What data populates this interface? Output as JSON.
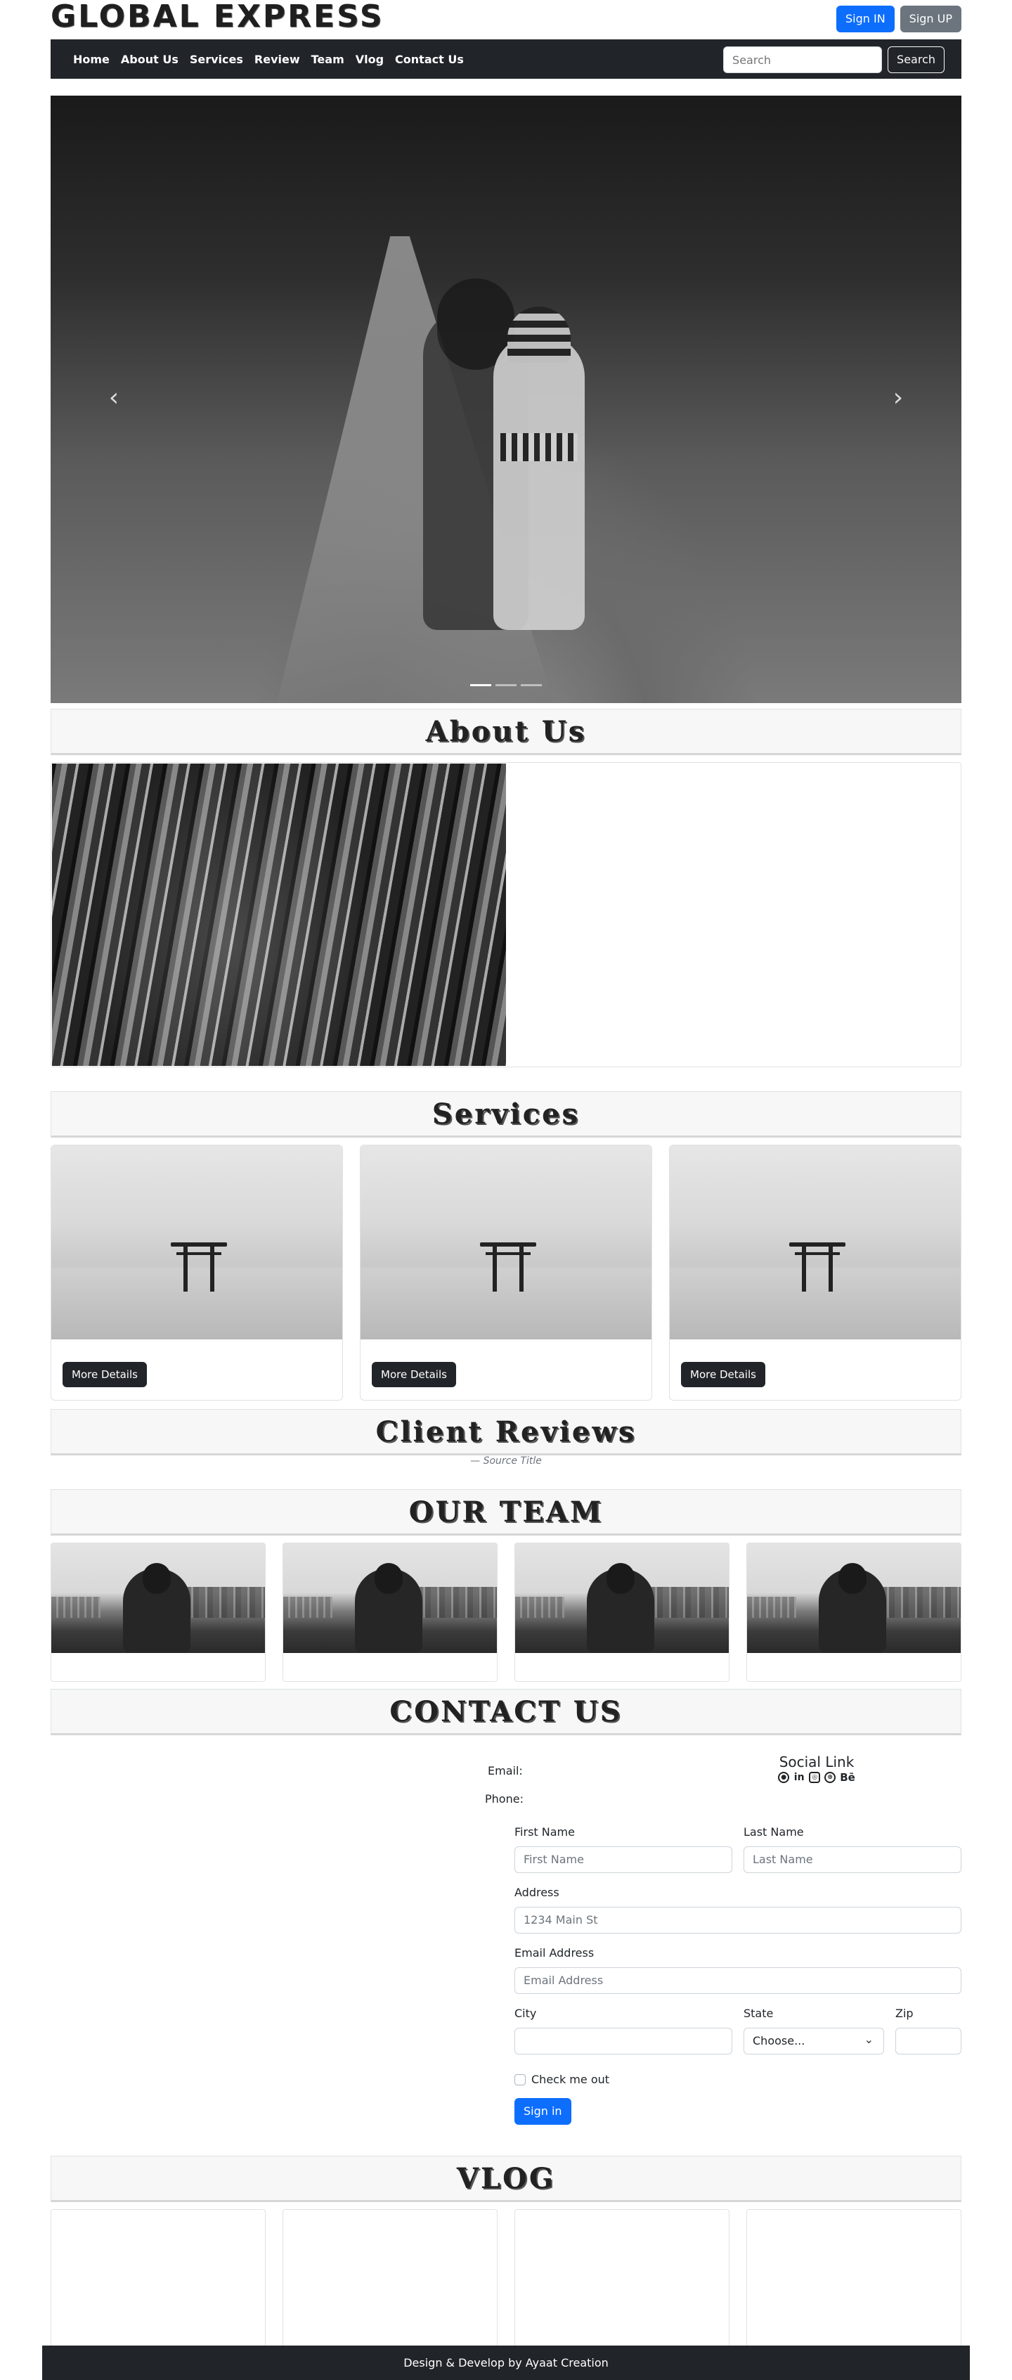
{
  "brand": "GLOBAL EXPRESS",
  "auth": {
    "sign_in": "Sign IN",
    "sign_up": "Sign UP"
  },
  "nav": {
    "items": [
      "Home",
      "About Us",
      "Services",
      "Review",
      "Team",
      "Vlog",
      "Contact Us"
    ],
    "search_placeholder": "Search",
    "search_button": "Search"
  },
  "carousel": {
    "prev_icon": "chevron-left-icon",
    "next_icon": "chevron-right-icon",
    "slide_count": 3,
    "active_slide": 1
  },
  "sections": {
    "about": "About Us",
    "services": "Services",
    "reviews": "Client Reviews",
    "team": "OUR TEAM",
    "contact": "CONTACT US",
    "vlog": "VLOG"
  },
  "services": {
    "cards": [
      {
        "button": "More Details"
      },
      {
        "button": "More Details"
      },
      {
        "button": "More Details"
      }
    ]
  },
  "reviews": {
    "source": "— Source Title"
  },
  "contact": {
    "email_label": "Email:",
    "phone_label": "Phone:",
    "social_title": "Social Link",
    "social_icons": [
      "github-icon",
      "linkedin-icon",
      "instagram-icon",
      "dribbble-icon",
      "behance-icon"
    ],
    "behance_text": "Bē"
  },
  "form": {
    "first_name_label": "First Name",
    "first_name_placeholder": "First Name",
    "last_name_label": "Last Name",
    "last_name_placeholder": "Last Name",
    "address_label": "Address",
    "address_placeholder": "1234 Main St",
    "email_label": "Email Address",
    "email_placeholder": "Email Address",
    "city_label": "City",
    "state_label": "State",
    "state_value": "Choose...",
    "zip_label": "Zip",
    "check_label": "Check me out",
    "submit": "Sign in"
  },
  "footer": "Design & Develop by Ayaat Creation"
}
